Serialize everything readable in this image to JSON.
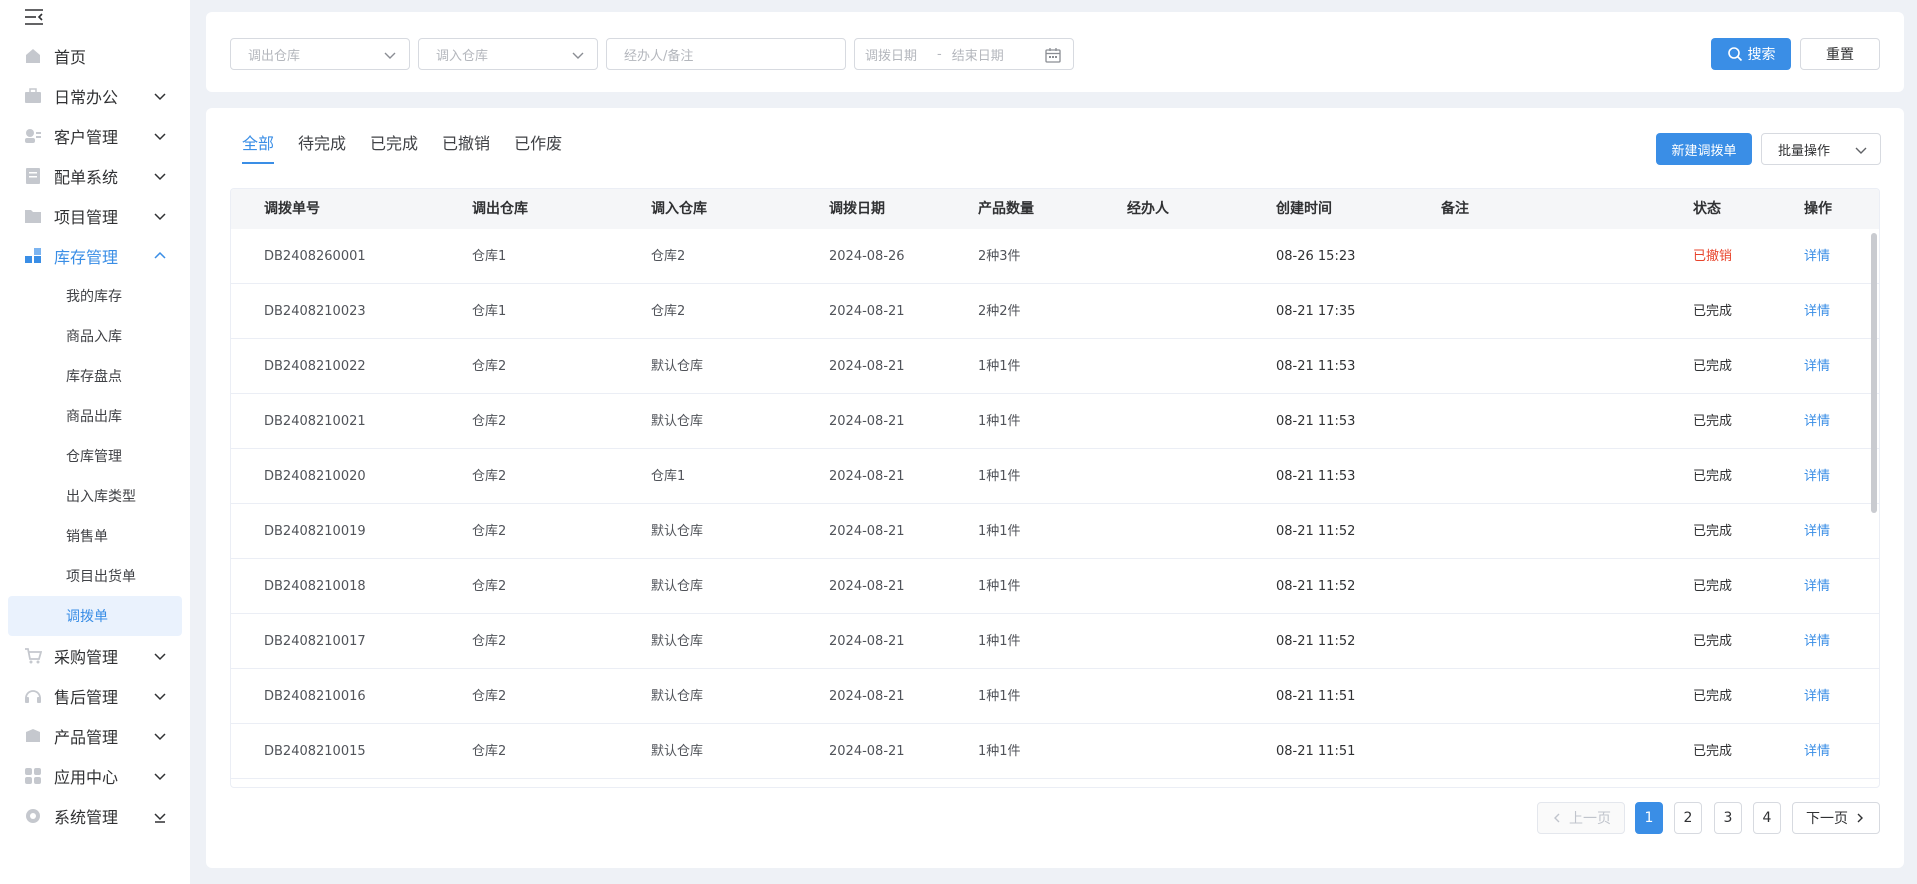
{
  "sidebar": {
    "items": [
      {
        "label": "首页",
        "icon": "home-icon"
      },
      {
        "label": "日常办公",
        "icon": "briefcase-icon"
      },
      {
        "label": "客户管理",
        "icon": "customer-icon"
      },
      {
        "label": "配单系统",
        "icon": "document-icon"
      },
      {
        "label": "项目管理",
        "icon": "folder-icon"
      },
      {
        "label": "库存管理",
        "icon": "inventory-icon"
      },
      {
        "label": "采购管理",
        "icon": "cart-icon"
      },
      {
        "label": "售后管理",
        "icon": "headset-icon"
      },
      {
        "label": "产品管理",
        "icon": "box-icon"
      },
      {
        "label": "应用中心",
        "icon": "apps-icon"
      },
      {
        "label": "系统管理",
        "icon": "settings-icon"
      }
    ],
    "sub_items": [
      "我的库存",
      "商品入库",
      "库存盘点",
      "商品出库",
      "仓库管理",
      "出入库类型",
      "销售单",
      "项目出货单",
      "调拨单"
    ]
  },
  "filters": {
    "out_warehouse_placeholder": "调出仓库",
    "in_warehouse_placeholder": "调入仓库",
    "handler_placeholder": "经办人/备注",
    "start_date_placeholder": "调拨日期",
    "date_separator": "-",
    "end_date_placeholder": "结束日期",
    "search_label": "搜索",
    "reset_label": "重置"
  },
  "tabs": [
    "全部",
    "待完成",
    "已完成",
    "已撤销",
    "已作废"
  ],
  "actions": {
    "new_label": "新建调拨单",
    "batch_label": "批量操作"
  },
  "table": {
    "headers": [
      "调拨单号",
      "调出仓库",
      "调入仓库",
      "调拨日期",
      "产品数量",
      "经办人",
      "创建时间",
      "备注",
      "状态",
      "操作"
    ],
    "rows": [
      {
        "no": "DB2408260001",
        "out": "仓库1",
        "in": "仓库2",
        "date": "2024-08-26",
        "qty": "2种3件",
        "handler": "",
        "created": "08-26 15:23",
        "remark": "",
        "status": "已撤销",
        "op": "详情"
      },
      {
        "no": "DB2408210023",
        "out": "仓库1",
        "in": "仓库2",
        "date": "2024-08-21",
        "qty": "2种2件",
        "handler": "",
        "created": "08-21 17:35",
        "remark": "",
        "status": "已完成",
        "op": "详情"
      },
      {
        "no": "DB2408210022",
        "out": "仓库2",
        "in": "默认仓库",
        "date": "2024-08-21",
        "qty": "1种1件",
        "handler": "",
        "created": "08-21 11:53",
        "remark": "",
        "status": "已完成",
        "op": "详情"
      },
      {
        "no": "DB2408210021",
        "out": "仓库2",
        "in": "默认仓库",
        "date": "2024-08-21",
        "qty": "1种1件",
        "handler": "",
        "created": "08-21 11:53",
        "remark": "",
        "status": "已完成",
        "op": "详情"
      },
      {
        "no": "DB2408210020",
        "out": "仓库2",
        "in": "仓库1",
        "date": "2024-08-21",
        "qty": "1种1件",
        "handler": "",
        "created": "08-21 11:53",
        "remark": "",
        "status": "已完成",
        "op": "详情"
      },
      {
        "no": "DB2408210019",
        "out": "仓库2",
        "in": "默认仓库",
        "date": "2024-08-21",
        "qty": "1种1件",
        "handler": "",
        "created": "08-21 11:52",
        "remark": "",
        "status": "已完成",
        "op": "详情"
      },
      {
        "no": "DB2408210018",
        "out": "仓库2",
        "in": "默认仓库",
        "date": "2024-08-21",
        "qty": "1种1件",
        "handler": "",
        "created": "08-21 11:52",
        "remark": "",
        "status": "已完成",
        "op": "详情"
      },
      {
        "no": "DB2408210017",
        "out": "仓库2",
        "in": "默认仓库",
        "date": "2024-08-21",
        "qty": "1种1件",
        "handler": "",
        "created": "08-21 11:52",
        "remark": "",
        "status": "已完成",
        "op": "详情"
      },
      {
        "no": "DB2408210016",
        "out": "仓库2",
        "in": "默认仓库",
        "date": "2024-08-21",
        "qty": "1种1件",
        "handler": "",
        "created": "08-21 11:51",
        "remark": "",
        "status": "已完成",
        "op": "详情"
      },
      {
        "no": "DB2408210015",
        "out": "仓库2",
        "in": "默认仓库",
        "date": "2024-08-21",
        "qty": "1种1件",
        "handler": "",
        "created": "08-21 11:51",
        "remark": "",
        "status": "已完成",
        "op": "详情"
      }
    ]
  },
  "pagination": {
    "prev_label": "上一页",
    "pages": [
      "1",
      "2",
      "3",
      "4"
    ],
    "next_label": "下一页"
  },
  "colors": {
    "accent": "#3a8ee6",
    "cancel": "#e8442c"
  }
}
